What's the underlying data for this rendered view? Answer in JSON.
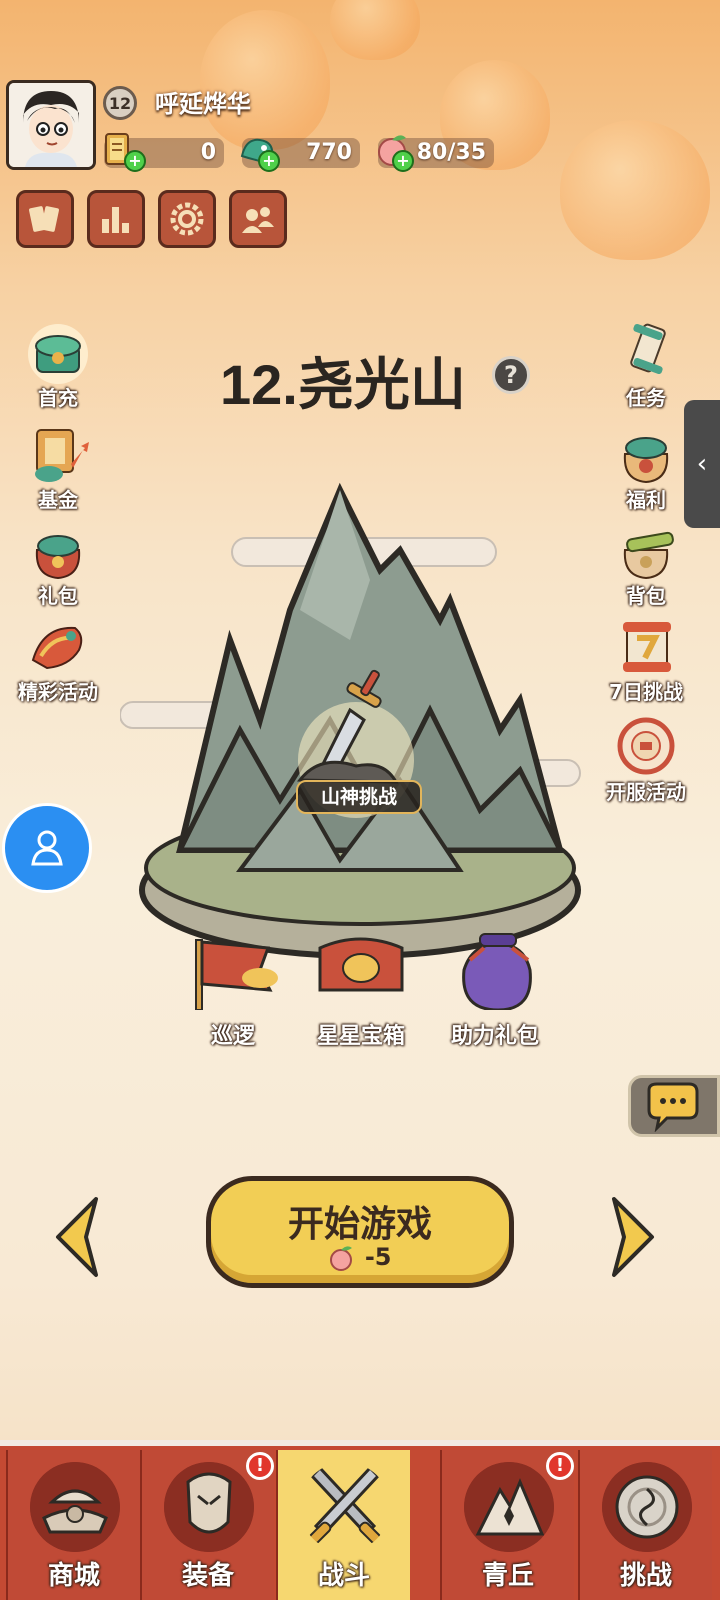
{
  "player": {
    "level": "12",
    "name": "呼延烨华"
  },
  "resources": [
    {
      "name": "scroll-ticket",
      "value": "0"
    },
    {
      "name": "jade-dragon",
      "value": "770"
    },
    {
      "name": "peach-stamina",
      "value": "80/35"
    }
  ],
  "top_menu": [
    "cards-icon",
    "ranking-icon",
    "settings-icon",
    "friends-icon"
  ],
  "left_icons": [
    {
      "label": "首充",
      "icon": "first-recharge-icon"
    },
    {
      "label": "基金",
      "icon": "fund-icon"
    },
    {
      "label": "礼包",
      "icon": "gift-pack-icon"
    },
    {
      "label": "精彩活动",
      "icon": "events-icon"
    }
  ],
  "right_icons": [
    {
      "label": "任务",
      "icon": "quest-icon"
    },
    {
      "label": "福利",
      "icon": "welfare-icon"
    },
    {
      "label": "背包",
      "icon": "backpack-icon"
    },
    {
      "label": "7日挑战",
      "icon": "seven-day-challenge-icon"
    },
    {
      "label": "开服活动",
      "icon": "server-launch-event-icon"
    }
  ],
  "stage": {
    "title": "12.尧光山",
    "help": "?",
    "boss_label": "山神挑战"
  },
  "stage_items": [
    {
      "label": "巡逻",
      "icon": "patrol-flag-icon"
    },
    {
      "label": "星星宝箱",
      "icon": "star-chest-icon"
    },
    {
      "label": "助力礼包",
      "icon": "support-bag-icon"
    }
  ],
  "start": {
    "label": "开始游戏",
    "cost": "-5"
  },
  "nav": [
    {
      "label": "商城",
      "icon": "shop-icon",
      "badge": false
    },
    {
      "label": "装备",
      "icon": "equipment-icon",
      "badge": true
    },
    {
      "label": "战斗",
      "icon": "battle-icon",
      "badge": false,
      "active": true
    },
    {
      "label": "青丘",
      "icon": "qingqiu-icon",
      "badge": true
    },
    {
      "label": "挑战",
      "icon": "challenge-icon",
      "badge": false
    }
  ],
  "badge_mark": "!",
  "side_tab_icon": "‹"
}
